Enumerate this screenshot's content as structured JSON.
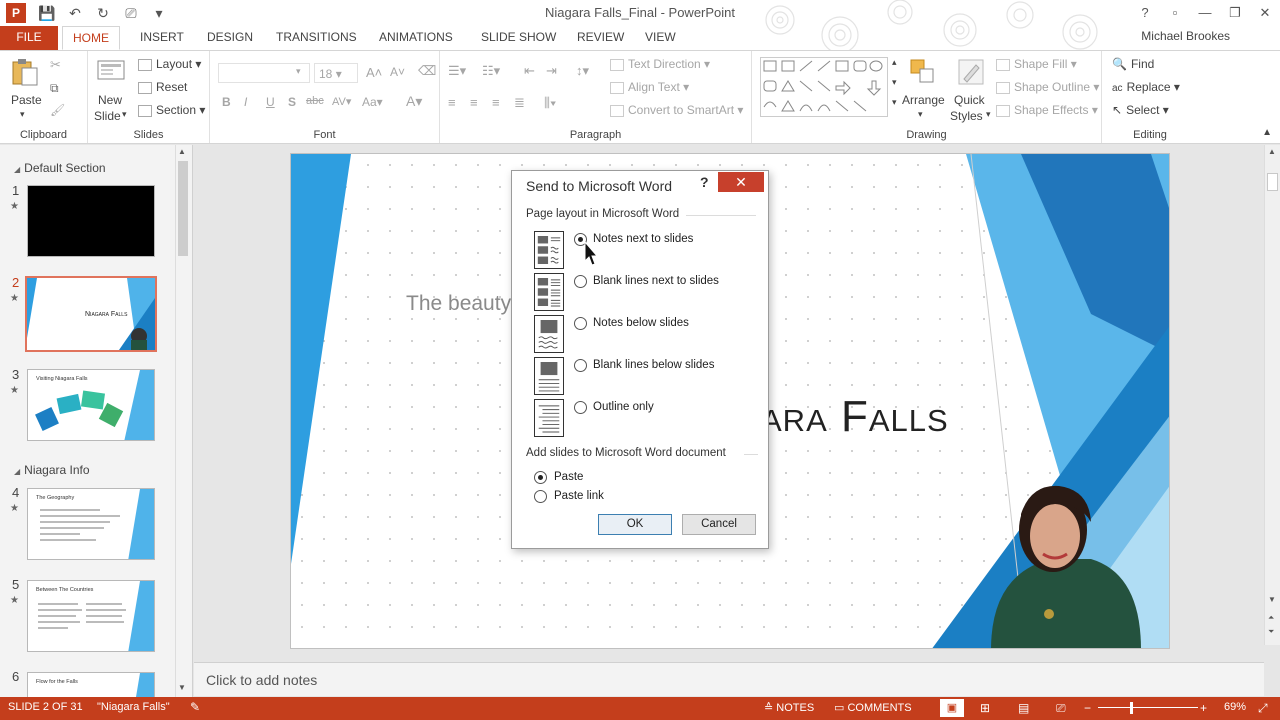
{
  "app": {
    "logo": "P",
    "title": "Niagara Falls_Final - PowerPoint",
    "user": "Michael Brookes"
  },
  "tabs": [
    "FILE",
    "HOME",
    "INSERT",
    "DESIGN",
    "TRANSITIONS",
    "ANIMATIONS",
    "SLIDE SHOW",
    "REVIEW",
    "VIEW"
  ],
  "ribbon": {
    "clipboard": {
      "label": "Clipboard",
      "paste": "Paste"
    },
    "slides": {
      "label": "Slides",
      "new_slide_1": "New",
      "new_slide_2": "Slide",
      "layout": "Layout",
      "reset": "Reset",
      "section": "Section"
    },
    "font": {
      "label": "Font",
      "size": "18"
    },
    "paragraph": {
      "label": "Paragraph",
      "text_direction": "Text Direction",
      "align_text": "Align Text",
      "convert_smartart": "Convert to SmartArt"
    },
    "drawing": {
      "label": "Drawing",
      "arrange": "Arrange",
      "quick_1": "Quick",
      "quick_2": "Styles",
      "shape_fill": "Shape Fill",
      "shape_outline": "Shape Outline",
      "shape_effects": "Shape Effects"
    },
    "editing": {
      "label": "Editing",
      "find": "Find",
      "replace": "Replace",
      "select": "Select"
    }
  },
  "slide_panel": {
    "sections": [
      "Default Section",
      "Niagara Info"
    ],
    "slide_numbers": [
      "1",
      "2",
      "3",
      "4",
      "5",
      "6"
    ],
    "thumb2_title": "Niagara Falls",
    "thumb3_title": "Visiting Niagara Falls",
    "thumb4_title": "The Geography",
    "thumb5_title": "Between The Countries",
    "thumb6_title": "Flow for the Falls"
  },
  "slide": {
    "subtitle": "The beauty",
    "title": "ara Falls"
  },
  "notes_placeholder": "Click to add notes",
  "status": {
    "slide_of": "SLIDE 2 OF 31",
    "theme": "\"Niagara Falls\"",
    "notes": "NOTES",
    "comments": "COMMENTS",
    "zoom": "69%"
  },
  "dialog": {
    "title": "Send to Microsoft Word",
    "help": "?",
    "close": "✕",
    "group1": "Page layout in Microsoft Word",
    "options": [
      "Notes next to slides",
      "Blank lines next to slides",
      "Notes below slides",
      "Blank lines below slides",
      "Outline only"
    ],
    "group2": "Add slides to Microsoft Word document",
    "paste_options": [
      "Paste",
      "Paste link"
    ],
    "ok": "OK",
    "cancel": "Cancel"
  },
  "colors": {
    "accent": "#c43e1c",
    "slide_blue": "#2e9ee0",
    "close_red": "#c7402c"
  }
}
